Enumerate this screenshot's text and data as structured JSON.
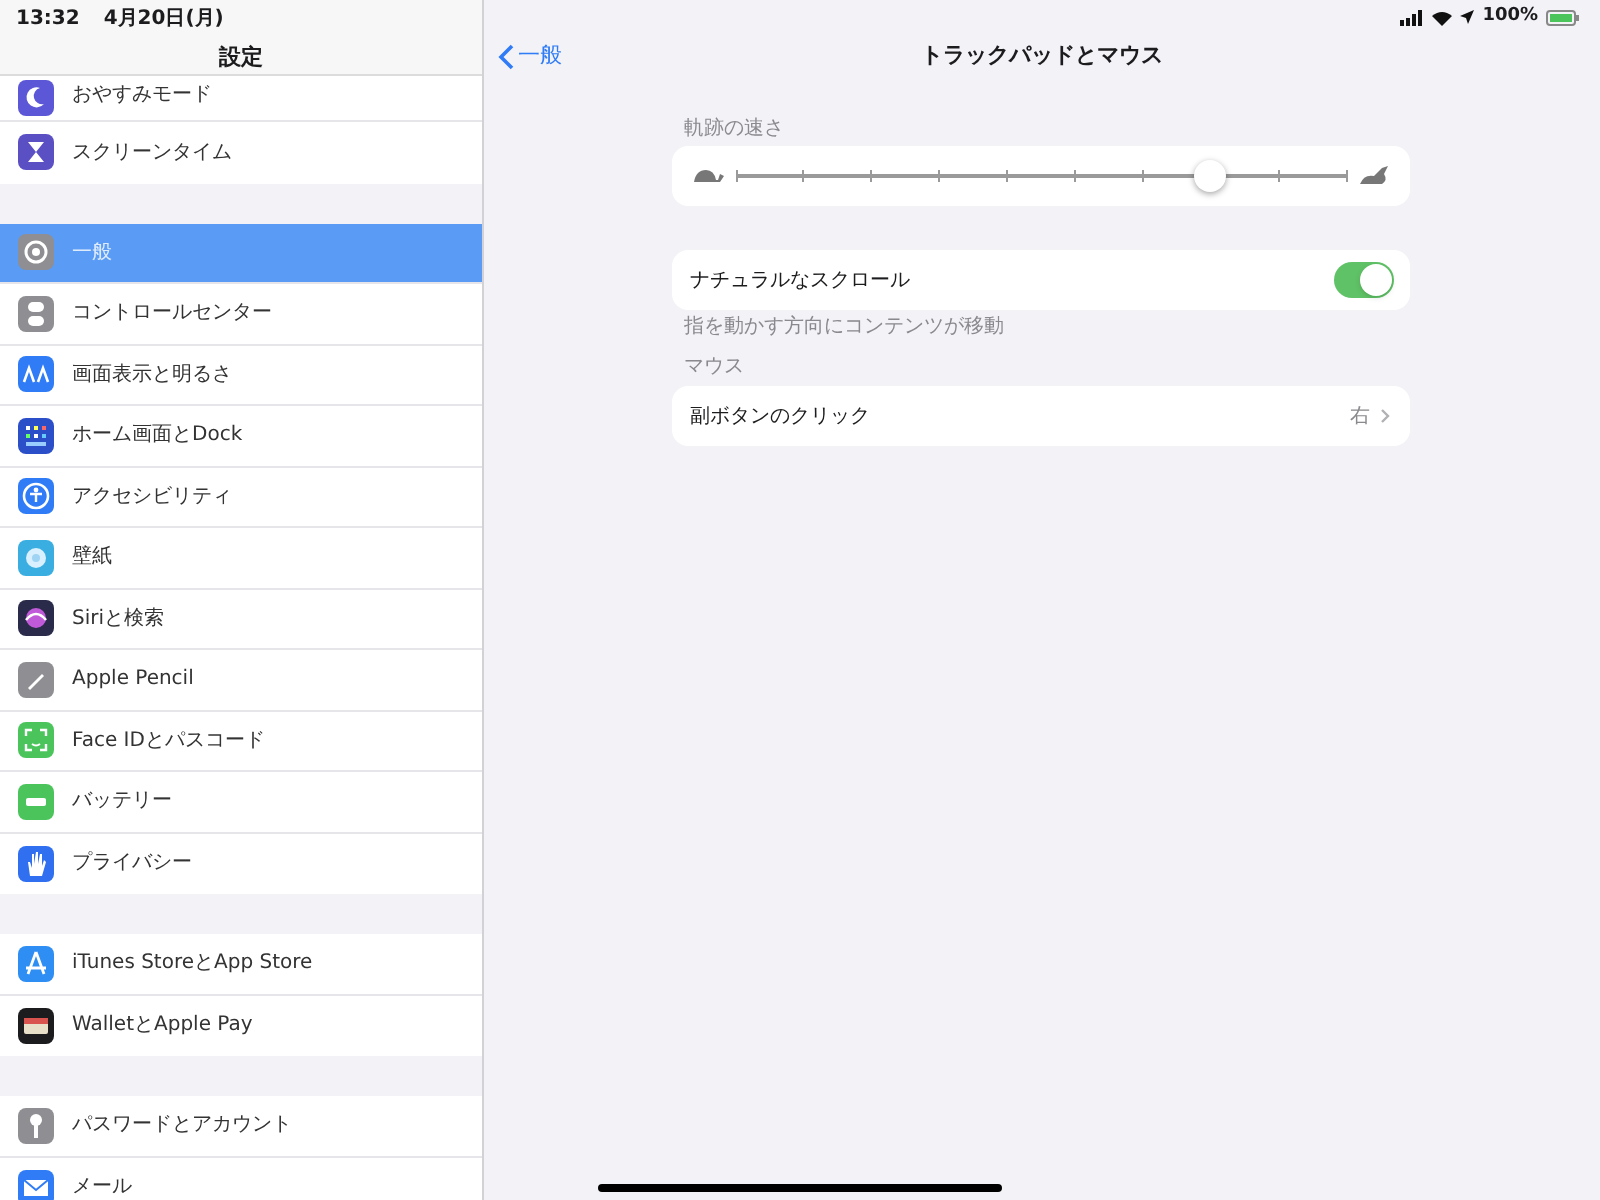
{
  "status_bar": {
    "time": "13:32",
    "date": "4月20日(月)",
    "battery": "100%"
  },
  "sidebar": {
    "title": "設定",
    "groups": [
      {
        "items": [
          {
            "label": "おやすみモード",
            "color": "#5b57d6",
            "selected": false
          },
          {
            "label": "スクリーンタイム",
            "color": "#5b4fc4",
            "selected": false
          }
        ]
      },
      {
        "items": [
          {
            "label": "一般",
            "color": "#8e8e93",
            "selected": true
          },
          {
            "label": "コントロールセンター",
            "color": "#8e8e93",
            "selected": false
          },
          {
            "label": "画面表示と明るさ",
            "color": "#2f7cf6",
            "selected": false
          },
          {
            "label": "ホーム画面とDock",
            "color": "#2b4ec9",
            "selected": false
          },
          {
            "label": "アクセシビリティ",
            "color": "#2f7cf6",
            "selected": false
          },
          {
            "label": "壁紙",
            "color": "#3aaee0",
            "selected": false
          },
          {
            "label": "Siriと検索",
            "color": "#2a2a4a",
            "selected": false
          },
          {
            "label": "Apple Pencil",
            "color": "#8e8e93",
            "selected": false
          },
          {
            "label": "Face IDとパスコード",
            "color": "#4cc45c",
            "selected": false
          },
          {
            "label": "バッテリー",
            "color": "#4cc45c",
            "selected": false
          },
          {
            "label": "プライバシー",
            "color": "#2f6ff0",
            "selected": false
          }
        ]
      },
      {
        "items": [
          {
            "label": "iTunes StoreとApp Store",
            "color": "#2e8ef3",
            "selected": false
          },
          {
            "label": "WalletとApple Pay",
            "color": "#1c1c1e",
            "selected": false
          }
        ]
      },
      {
        "items": [
          {
            "label": "パスワードとアカウント",
            "color": "#8e8e93",
            "selected": false
          },
          {
            "label": "メール",
            "color": "#2f7cf6",
            "selected": false
          }
        ]
      }
    ]
  },
  "detail": {
    "back": "一般",
    "title": "トラックパッドとマウス",
    "speed": {
      "caption": "軌跡の速さ",
      "level": 0.778
    },
    "natural_scroll": {
      "label": "ナチュラルなスクロール",
      "on": true,
      "footnote": "指を動かす方向にコンテンツが移動"
    },
    "mouse": {
      "caption": "マウス",
      "row": {
        "label": "副ボタンのクリック",
        "value": "右"
      }
    }
  }
}
